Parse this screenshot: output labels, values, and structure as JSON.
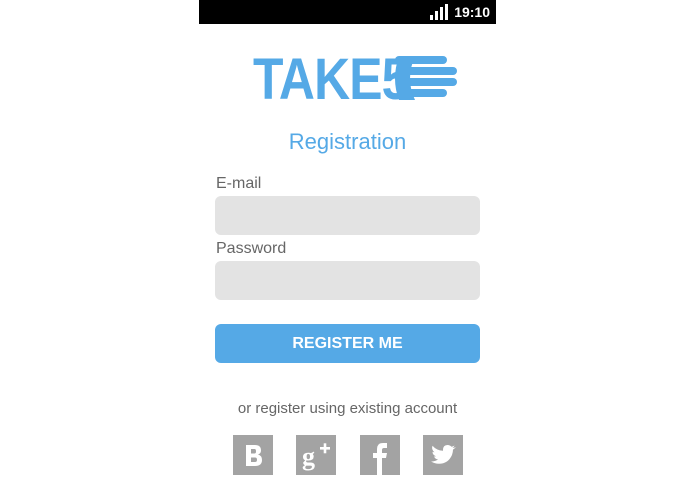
{
  "status_bar": {
    "time": "19:10",
    "icons": [
      "signal-icon"
    ]
  },
  "brand": {
    "logo_text": "TAKE5",
    "color": "#55a9e6"
  },
  "form": {
    "title": "Registration",
    "email_label": "E-mail",
    "email_value": "",
    "password_label": "Password",
    "password_value": "",
    "submit_label": "REGISTER ME"
  },
  "social": {
    "caption": "or register using existing account",
    "buttons": [
      {
        "icon": "vk-icon",
        "glyph": "B"
      },
      {
        "icon": "google-plus-icon",
        "glyph": "g+"
      },
      {
        "icon": "facebook-icon",
        "glyph": "f"
      },
      {
        "icon": "twitter-icon",
        "glyph": "bird"
      }
    ],
    "color": "#a3a3a3"
  }
}
